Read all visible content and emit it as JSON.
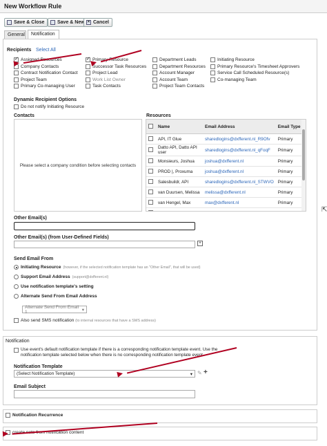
{
  "window": {
    "title": "New Workflow Rule"
  },
  "toolbar": {
    "save_close": "Save & Close",
    "save_new": "Save & New",
    "cancel": "Cancel"
  },
  "tabs": [
    {
      "label": "General"
    },
    {
      "label": "Notification"
    }
  ],
  "recipients": {
    "heading": "Recipients",
    "select_all": "Select All",
    "options": [
      {
        "label": "Assigned Resources",
        "checked": true
      },
      {
        "label": "Company Contacts",
        "checked": false
      },
      {
        "label": "Contract Notification Contact",
        "checked": false
      },
      {
        "label": "Project Team",
        "checked": false
      },
      {
        "label": "Primary Co-managing User",
        "checked": false
      },
      {
        "label": "Primary Resource",
        "checked": true
      },
      {
        "label": "Successor Task Resources",
        "checked": false
      },
      {
        "label": "Project Lead",
        "checked": false
      },
      {
        "label": "Work List Owner",
        "checked": false
      },
      {
        "label": "Task Contacts",
        "checked": false
      },
      {
        "label": "Department Leads",
        "checked": false
      },
      {
        "label": "Department Resources",
        "checked": false
      },
      {
        "label": "Account Manager",
        "checked": false
      },
      {
        "label": "Account Team",
        "checked": false
      },
      {
        "label": "Project Team Contacts",
        "checked": false
      },
      {
        "label": "Initiating Resource",
        "checked": false
      },
      {
        "label": "Primary Resource's Timesheet Approvers",
        "checked": false
      },
      {
        "label": "Service Call Scheduled Resource(s)",
        "checked": false
      },
      {
        "label": "Co-managing Team",
        "checked": false
      }
    ]
  },
  "dynamic": {
    "heading": "Dynamic Recipient Options",
    "do_not_notify": "Do not notify Initiating Resource"
  },
  "contacts": {
    "heading": "Contacts",
    "placeholder": "Please select a company condition before selecting contacts"
  },
  "resources": {
    "heading": "Resources",
    "columns": [
      "Name",
      "Email Address",
      "Email Type"
    ],
    "rows": [
      {
        "name": "API, IT Glue",
        "email": "sharedlogins@dxfferent.nl_R9Ofv",
        "type": "Primary"
      },
      {
        "name": "Datto API, Datto API user",
        "email": "sharedlogins@dxfferent.nl_qFoqF",
        "type": "Primary"
      },
      {
        "name": "Monsieurs, Joshua",
        "email": "joshua@dxfferent.nl",
        "type": "Primary"
      },
      {
        "name": "PROD |, Proxuma",
        "email": "joshua@dxfferent.nl",
        "type": "Primary"
      },
      {
        "name": "Salesbuildr, API",
        "email": "sharedlogins@dxfferent.nl_STWVO",
        "type": "Primary"
      },
      {
        "name": "van Duursen, Melissa",
        "email": "melissa@dxfferent.nl",
        "type": "Primary"
      },
      {
        "name": "van Hengel, Max",
        "email": "max@dxfferent.nl",
        "type": "Primary"
      },
      {
        "name": "van Lent, David",
        "email": "david@dxfferent.nl",
        "type": "Primary"
      }
    ]
  },
  "other_emails": {
    "label": "Other Email(s)",
    "value": ""
  },
  "udf_emails": {
    "label": "Other Email(s) (from User-Defined Fields)"
  },
  "send_from": {
    "heading": "Send Email From",
    "options": [
      {
        "label": "Initiating Resource",
        "hint": "(however, if the selected notification template has an \"Other Email\", that will be used)",
        "checked": true
      },
      {
        "label": "Support Email Address",
        "hint": "(support@dxfferent.nl)",
        "checked": false
      },
      {
        "label": "Use notification template's setting",
        "hint": "",
        "checked": false
      },
      {
        "label": "Alternate Send From Email Address",
        "hint": "",
        "checked": false
      }
    ],
    "alternate_select": "Alternate Send From Email 1"
  },
  "sms": {
    "label": "Also send SMS notification",
    "hint": "(to internal resources that have a SMS address)"
  },
  "notification": {
    "heading": "Notification",
    "use_event_text": "Use event's default notification template if there is a corresponding notification template event. Use the notification template selected below when there is no corresponding notification template event.",
    "template_label": "Notification Template",
    "template_value": "(Select Notification Template)",
    "subject_label": "Email Subject",
    "subject_value": ""
  },
  "recurrence": {
    "label": "Notification Recurrence"
  },
  "create_note": {
    "label": "create note from notification content"
  },
  "colors": {
    "annotation_arrow": "#b00020",
    "link": "#2a65b8"
  }
}
